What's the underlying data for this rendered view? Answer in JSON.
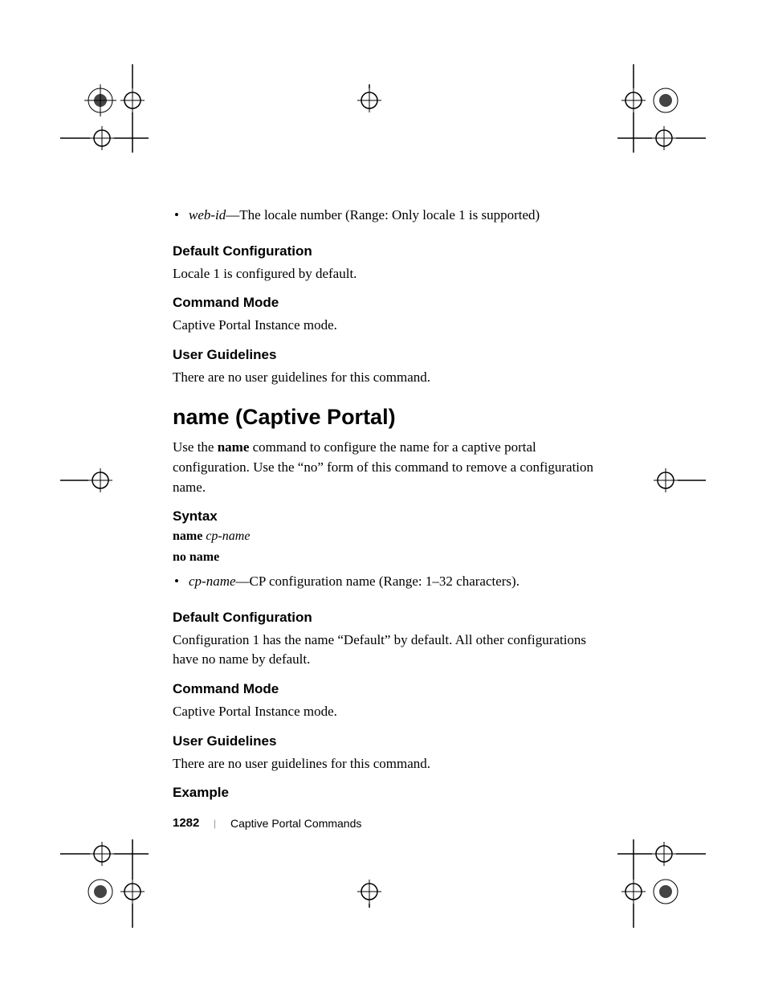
{
  "bullet1_param": "web-id",
  "bullet1_text": "—The locale number  (Range: Only locale 1 is supported)",
  "section1": {
    "heading": "Default Configuration",
    "body": "Locale 1 is configured by default."
  },
  "section2": {
    "heading": "Command Mode",
    "body": "Captive Portal Instance mode."
  },
  "section3": {
    "heading": "User Guidelines",
    "body": "There are no user guidelines for this command."
  },
  "main_heading": "name (Captive Portal)",
  "intro_p1": "Use the ",
  "intro_bold": "name",
  "intro_p2": " command to configure the name for a captive portal configuration. Use the “no” form of this command to remove a configuration name.",
  "syntax": {
    "heading": "Syntax",
    "line1_bold": "name ",
    "line1_italic": "cp-name",
    "line2": "no name",
    "bullet_param": "cp-name",
    "bullet_text": "—CP configuration name (Range: 1–32 characters)."
  },
  "section4": {
    "heading": "Default Configuration",
    "body": "Configuration 1 has the name “Default” by default. All other configurations have no name by default."
  },
  "section5": {
    "heading": "Command Mode",
    "body": "Captive Portal Instance mode."
  },
  "section6": {
    "heading": "User Guidelines",
    "body": "There are no user guidelines for this command."
  },
  "section7": {
    "heading": "Example"
  },
  "footer": {
    "page_number": "1282",
    "chapter": "Captive Portal Commands"
  }
}
